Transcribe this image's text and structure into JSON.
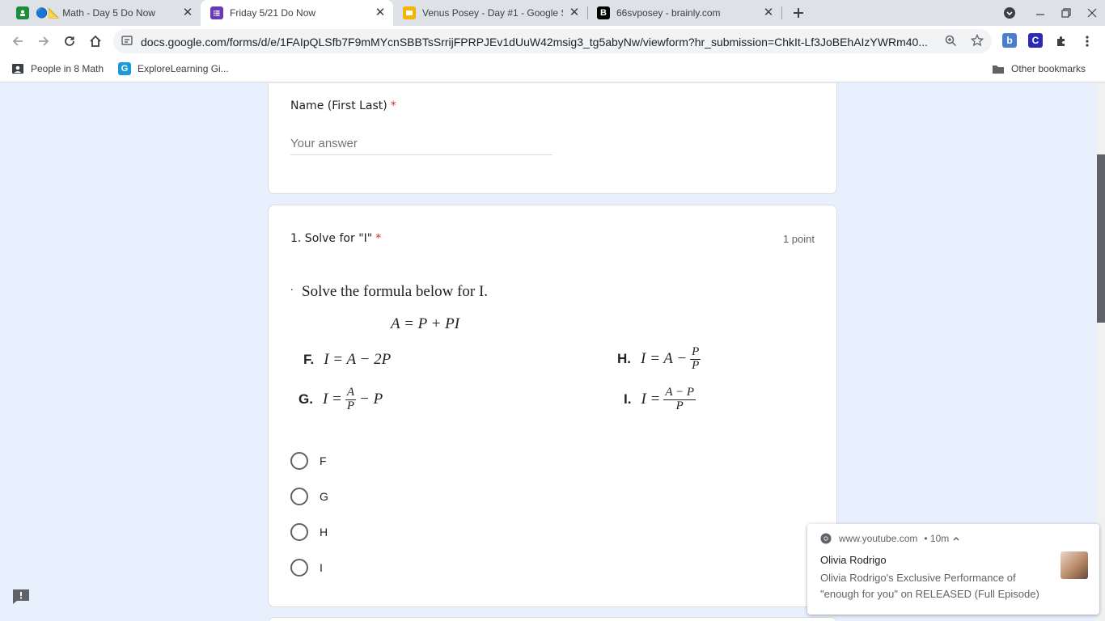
{
  "browser": {
    "tabs": [
      {
        "title": "🔵📐 Math - Day 5 Do Now",
        "active": false
      },
      {
        "title": "Friday 5/21 Do Now",
        "active": true
      },
      {
        "title": "Venus Posey - Day #1 - Google S",
        "active": false
      },
      {
        "title": "66svposey - brainly.com",
        "active": false
      }
    ],
    "url": "docs.google.com/forms/d/e/1FAIpQLSfb7F9mMYcnSBBTsSrrijFPRPJEv1dUuW42msig3_tg5abyNw/viewform?hr_submission=ChkIt-Lf3JoBEhAIzYWRm40...",
    "bookmarks": [
      {
        "label": "People in 8 Math",
        "icon": "contacts-icon"
      },
      {
        "label": "ExploreLearning Gi...",
        "icon": "explorelearning-icon"
      }
    ],
    "other_bookmarks": "Other bookmarks",
    "extensions": [
      "b",
      "C"
    ],
    "colors": {
      "tabstrip": "#dee1e6",
      "page_bg": "#e8f0fe",
      "accent_purple": "#673ab7"
    }
  },
  "form": {
    "name_question": {
      "title": "Name (First Last)",
      "required_mark": "*",
      "placeholder": "Your answer"
    },
    "question1": {
      "title": "1. Solve for \"I\"",
      "required_mark": "*",
      "points": "1 point",
      "image": {
        "bullet": ".",
        "prompt": "Solve the formula below for I.",
        "formula": "A = P + PI",
        "option_F": {
          "letter": "F.",
          "lhs": "I = A − 2P"
        },
        "option_G": {
          "letter": "G.",
          "lhs": "I =",
          "num": "A",
          "den": "P",
          "rhs": "− P"
        },
        "option_H": {
          "letter": "H.",
          "lhs": "I = A −",
          "num": "P",
          "den": "P"
        },
        "option_I": {
          "letter": "I.",
          "lhs": "I =",
          "num": "A − P",
          "den": "P"
        }
      },
      "choices": [
        "F",
        "G",
        "H",
        "I"
      ]
    }
  },
  "notification": {
    "source": "www.youtube.com",
    "age": "• 10m",
    "title": "Olivia Rodrigo",
    "body": "Olivia Rodrigo's Exclusive Performance of \"enough for you\" on RELEASED (Full Episode)"
  }
}
